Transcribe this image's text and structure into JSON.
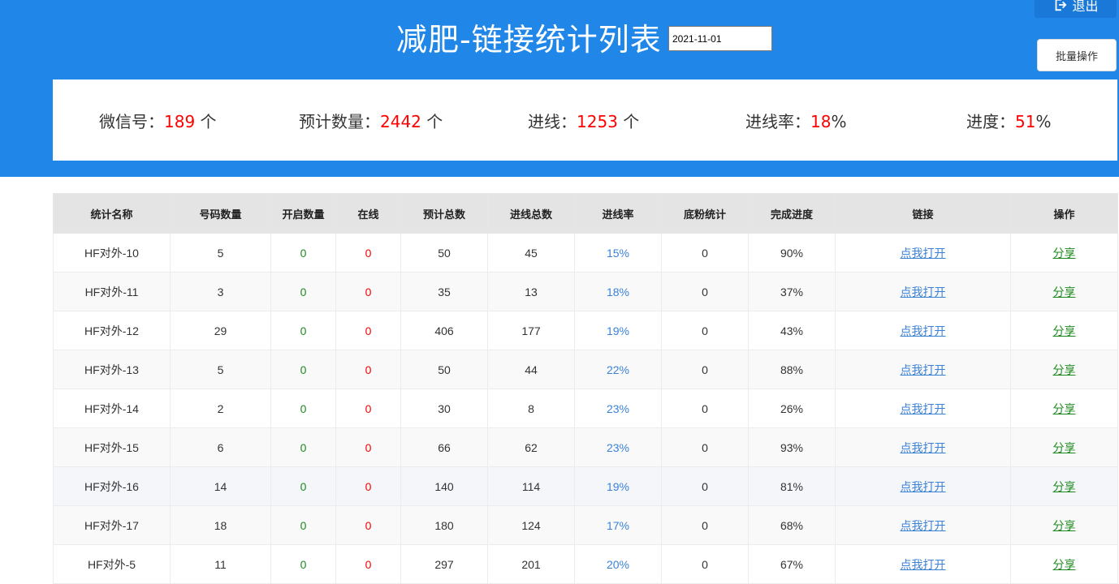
{
  "header": {
    "title": "减肥-链接统计列表",
    "date_value": "2021-11-01",
    "exit_label": "退出",
    "batch_label": "批量操作"
  },
  "stats": {
    "wechat_label": "微信号：",
    "wechat_value": "189",
    "wechat_unit": " 个",
    "expected_label": "预计数量：",
    "expected_value": "2442",
    "expected_unit": " 个",
    "joined_label": "进线：",
    "joined_value": "1253",
    "joined_unit": " 个",
    "rate_label": "进线率：",
    "rate_value": "18",
    "rate_unit": "%",
    "progress_label": "进度：",
    "progress_value": "51",
    "progress_unit": "%"
  },
  "table": {
    "headers": [
      "统计名称",
      "号码数量",
      "开启数量",
      "在线",
      "预计总数",
      "进线总数",
      "进线率",
      "底粉统计",
      "完成进度",
      "链接",
      "操作"
    ],
    "link_label": "点我打开",
    "share_label": "分享",
    "rows": [
      {
        "name": "HF对外-10",
        "count": "5",
        "open": "0",
        "online": "0",
        "expected": "50",
        "joined": "45",
        "rate": "15%",
        "base": "0",
        "progress": "90%"
      },
      {
        "name": "HF对外-11",
        "count": "3",
        "open": "0",
        "online": "0",
        "expected": "35",
        "joined": "13",
        "rate": "18%",
        "base": "0",
        "progress": "37%"
      },
      {
        "name": "HF对外-12",
        "count": "29",
        "open": "0",
        "online": "0",
        "expected": "406",
        "joined": "177",
        "rate": "19%",
        "base": "0",
        "progress": "43%"
      },
      {
        "name": "HF对外-13",
        "count": "5",
        "open": "0",
        "online": "0",
        "expected": "50",
        "joined": "44",
        "rate": "22%",
        "base": "0",
        "progress": "88%"
      },
      {
        "name": "HF对外-14",
        "count": "2",
        "open": "0",
        "online": "0",
        "expected": "30",
        "joined": "8",
        "rate": "23%",
        "base": "0",
        "progress": "26%"
      },
      {
        "name": "HF对外-15",
        "count": "6",
        "open": "0",
        "online": "0",
        "expected": "66",
        "joined": "62",
        "rate": "23%",
        "base": "0",
        "progress": "93%"
      },
      {
        "name": "HF对外-16",
        "count": "14",
        "open": "0",
        "online": "0",
        "expected": "140",
        "joined": "114",
        "rate": "19%",
        "base": "0",
        "progress": "81%"
      },
      {
        "name": "HF对外-17",
        "count": "18",
        "open": "0",
        "online": "0",
        "expected": "180",
        "joined": "124",
        "rate": "17%",
        "base": "0",
        "progress": "68%"
      },
      {
        "name": "HF对外-5",
        "count": "11",
        "open": "0",
        "online": "0",
        "expected": "297",
        "joined": "201",
        "rate": "20%",
        "base": "0",
        "progress": "67%"
      }
    ]
  },
  "colors": {
    "header_bg": "#2087e8",
    "highlight_red": "#ff0000",
    "green": "#1e8a1e",
    "blue": "#3a82d6"
  }
}
